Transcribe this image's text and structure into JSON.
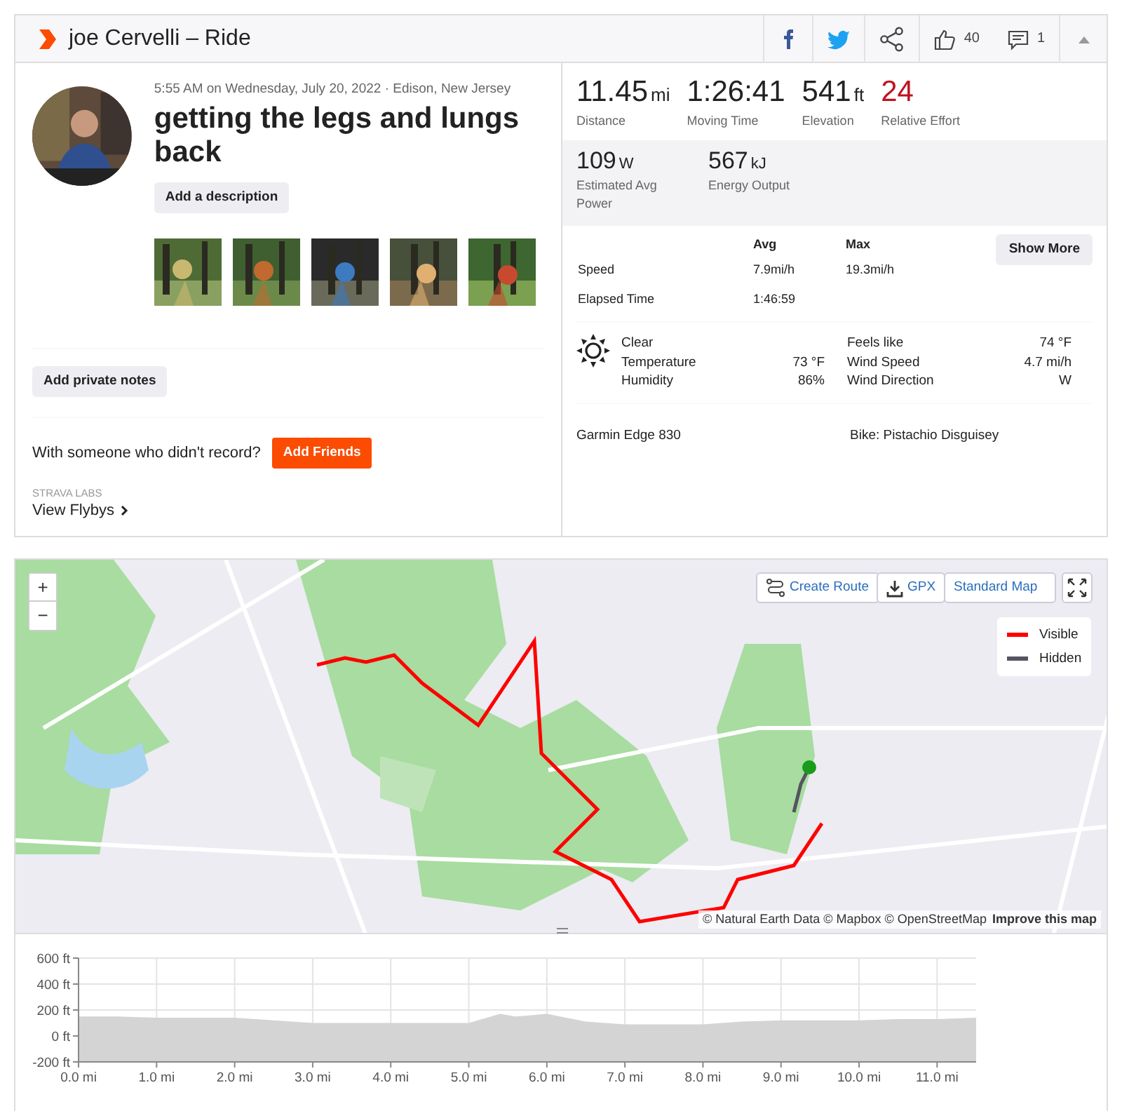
{
  "header": {
    "title": "joe Cervelli – Ride",
    "kudos_count": "40",
    "comment_count": "1"
  },
  "activity": {
    "date_location": "5:55 AM on Wednesday, July 20, 2022 · Edison, New Jersey",
    "title": "getting the legs and lungs back",
    "add_description": "Add a description",
    "add_notes": "Add private notes",
    "friends_prompt": "With someone who didn't record?",
    "add_friends": "Add Friends",
    "labs_caption": "STRAVA LABS",
    "flybys_link": "View Flybys"
  },
  "stats": {
    "primary": [
      {
        "kind": "metric",
        "value": "11.45",
        "unit": "mi",
        "label": "Distance"
      },
      {
        "kind": "metric",
        "value": "1:26:41",
        "label": "Moving Time"
      },
      {
        "kind": "metric",
        "value": "541",
        "unit": "ft",
        "label": "Elevation"
      },
      {
        "kind": "effort",
        "value": "24",
        "label": "Relative Effort"
      }
    ],
    "secondary": [
      {
        "value": "109",
        "unit": "W",
        "label": "Estimated Avg Power"
      },
      {
        "value": "567",
        "unit": "kJ",
        "label": "Energy Output"
      }
    ],
    "columns": [
      "Avg",
      "Max"
    ],
    "rows": [
      {
        "label": "Speed",
        "avg": "7.9mi/h",
        "max": "19.3mi/h"
      },
      {
        "label": "Elapsed Time",
        "avg": "1:46:59"
      }
    ],
    "show_more": "Show More"
  },
  "weather": {
    "left": [
      {
        "label": "Clear"
      },
      {
        "label": "Temperature",
        "value": "73 °F"
      },
      {
        "label": "Humidity",
        "value": "86%"
      }
    ],
    "right": [
      {
        "label": "Feels like",
        "value": "74 °F"
      },
      {
        "label": "Wind Speed",
        "value": "4.7 mi/h"
      },
      {
        "label": "Wind Direction",
        "value": "W"
      }
    ]
  },
  "gear": {
    "device": "Garmin Edge 830",
    "bike": "Bike: Pistachio Disguisey"
  },
  "map": {
    "zoom_in": "+",
    "zoom_out": "−",
    "create_route": "Create Route",
    "gpx": "GPX",
    "map_style": "Standard Map",
    "legend": [
      {
        "label": "Visible",
        "color": "#ff0000"
      },
      {
        "label": "Hidden",
        "color": "#555560"
      }
    ],
    "attribution": "© Natural Earth Data © Mapbox © OpenStreetMap",
    "improve_link": "Improve this map"
  },
  "elevation": {
    "chart_data": {
      "type": "area",
      "xlim": [
        0,
        11.5
      ],
      "ylim": [
        -200,
        600
      ],
      "xticks": [
        {
          "value": 0,
          "label": "0.0 mi"
        },
        {
          "value": 1,
          "label": "1.0 mi"
        },
        {
          "value": 2,
          "label": "2.0 mi"
        },
        {
          "value": 3,
          "label": "3.0 mi"
        },
        {
          "value": 4,
          "label": "4.0 mi"
        },
        {
          "value": 5,
          "label": "5.0 mi"
        },
        {
          "value": 6,
          "label": "6.0 mi"
        },
        {
          "value": 7,
          "label": "7.0 mi"
        },
        {
          "value": 8,
          "label": "8.0 mi"
        },
        {
          "value": 9,
          "label": "9.0 mi"
        },
        {
          "value": 10,
          "label": "10.0 mi"
        },
        {
          "value": 11,
          "label": "11.0 mi"
        }
      ],
      "yticks": [
        {
          "value": -200,
          "label": "-200 ft"
        },
        {
          "value": 0,
          "label": "0 ft"
        },
        {
          "value": 200,
          "label": "200 ft"
        },
        {
          "value": 400,
          "label": "400 ft"
        },
        {
          "value": 600,
          "label": "600 ft"
        }
      ],
      "x": [
        0,
        0.5,
        1,
        1.5,
        2,
        2.5,
        3,
        3.5,
        4,
        4.5,
        5,
        5.4,
        5.6,
        6,
        6.5,
        7,
        7.5,
        8,
        8.5,
        9,
        9.5,
        10,
        10.5,
        11,
        11.5
      ],
      "grid": true,
      "series": [
        {
          "color": "#d4d4d4",
          "values": [
            150,
            150,
            140,
            140,
            140,
            120,
            100,
            100,
            100,
            100,
            100,
            170,
            150,
            170,
            110,
            90,
            90,
            90,
            110,
            120,
            120,
            120,
            130,
            130,
            140
          ]
        }
      ]
    }
  }
}
